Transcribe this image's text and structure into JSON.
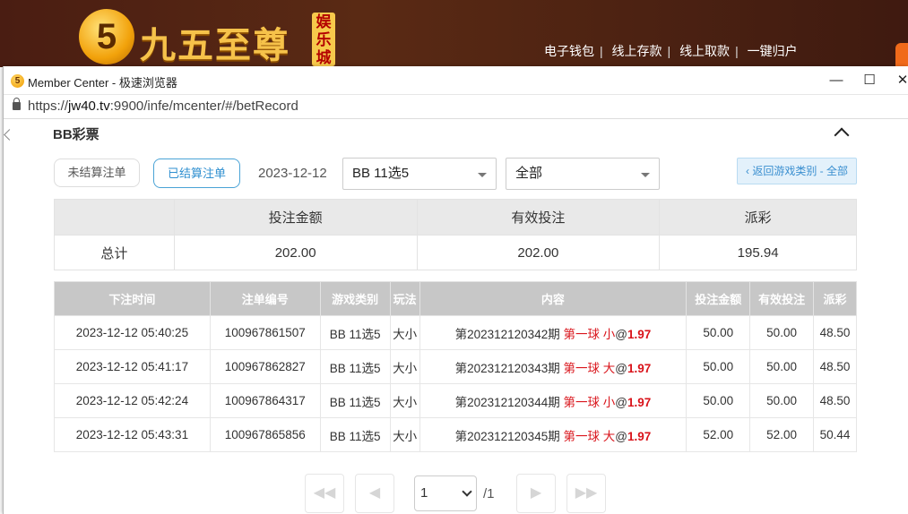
{
  "site": {
    "logo_digit": "5",
    "logo_title": "九五至尊",
    "logo_badge": "娱乐城",
    "links": [
      "电子钱包",
      "线上存款",
      "线上取款",
      "一键归户"
    ]
  },
  "browser": {
    "title": "Member Center - 极速浏览器",
    "url_host": "jw40.tv",
    "url_prefix": "https://",
    "url_rest": ":9900/infe/mcenter/#/betRecord",
    "minimize": "—",
    "maximize": "☐",
    "close": "✕"
  },
  "page": {
    "section_title": "BB彩票",
    "filters": {
      "unsettled_label": "未结算注单",
      "settled_label": "已结算注单",
      "date": "2023-12-12",
      "game_select": "BB 11选5",
      "type_select": "全部",
      "back_label": "‹ 返回游戏类别 - 全部"
    },
    "summary": {
      "headers": [
        "",
        "投注金额",
        "有效投注",
        "派彩"
      ],
      "row": [
        "总计",
        "202.00",
        "202.00",
        "195.94"
      ]
    },
    "records": {
      "headers": [
        "下注时间",
        "注单编号",
        "游戏类别",
        "玩法",
        "内容",
        "投注金额",
        "有效投注",
        "派彩"
      ],
      "rows": [
        {
          "time": "2023-12-12 05:40:25",
          "id": "100967861507",
          "game": "BB 11选5",
          "play": "大小",
          "period": "第202312120342期",
          "pick": "第一球 小",
          "at": "@",
          "odds": "1.97",
          "amount": "50.00",
          "valid": "50.00",
          "payout": "48.50"
        },
        {
          "time": "2023-12-12 05:41:17",
          "id": "100967862827",
          "game": "BB 11选5",
          "play": "大小",
          "period": "第202312120343期",
          "pick": "第一球 大",
          "at": "@",
          "odds": "1.97",
          "amount": "50.00",
          "valid": "50.00",
          "payout": "48.50"
        },
        {
          "time": "2023-12-12 05:42:24",
          "id": "100967864317",
          "game": "BB 11选5",
          "play": "大小",
          "period": "第202312120344期",
          "pick": "第一球 小",
          "at": "@",
          "odds": "1.97",
          "amount": "50.00",
          "valid": "50.00",
          "payout": "48.50"
        },
        {
          "time": "2023-12-12 05:43:31",
          "id": "100967865856",
          "game": "BB 11选5",
          "play": "大小",
          "period": "第202312120345期",
          "pick": "第一球 大",
          "at": "@",
          "odds": "1.97",
          "amount": "52.00",
          "valid": "52.00",
          "payout": "50.44"
        }
      ]
    },
    "pager": {
      "first": "◀◀",
      "prev": "◀",
      "page": "1",
      "total": "/1",
      "next": "▶",
      "last": "▶▶"
    }
  },
  "colors": {
    "accent_blue": "#2f8fd0",
    "highlight_red": "#d9141b",
    "table_header": "#c7c7c7"
  }
}
